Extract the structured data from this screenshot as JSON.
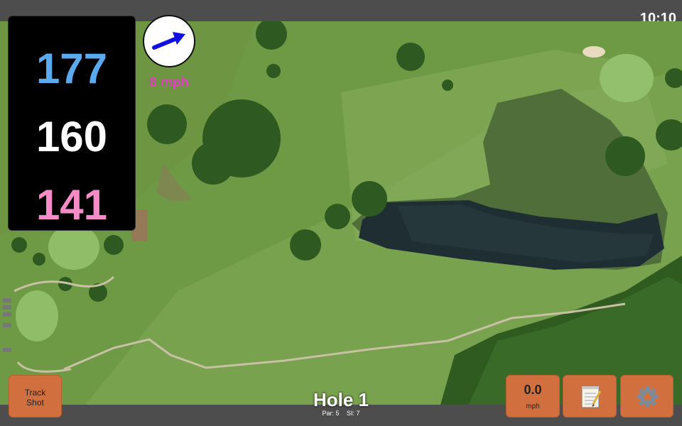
{
  "status": {
    "time": "10:10"
  },
  "distances": {
    "back": "177",
    "middle": "160",
    "front": "141"
  },
  "wind": {
    "speed_label": "8 mph",
    "direction_icon": "arrow-icon"
  },
  "hole": {
    "title": "Hole 1",
    "par_label": "Par: 5",
    "si_label": "SI: 7"
  },
  "buttons": {
    "track_shot_line1": "Track",
    "track_shot_line2": "Shot",
    "speed_value": "0.0",
    "speed_unit": "mph",
    "notes_icon": "notepad-icon",
    "settings_icon": "gear-icon"
  },
  "colors": {
    "back_distance": "#5aaaf0",
    "middle_distance": "#ffffff",
    "front_distance": "#f58cc8",
    "wind_label": "#e040c0",
    "button_bg": "#d1703e"
  }
}
